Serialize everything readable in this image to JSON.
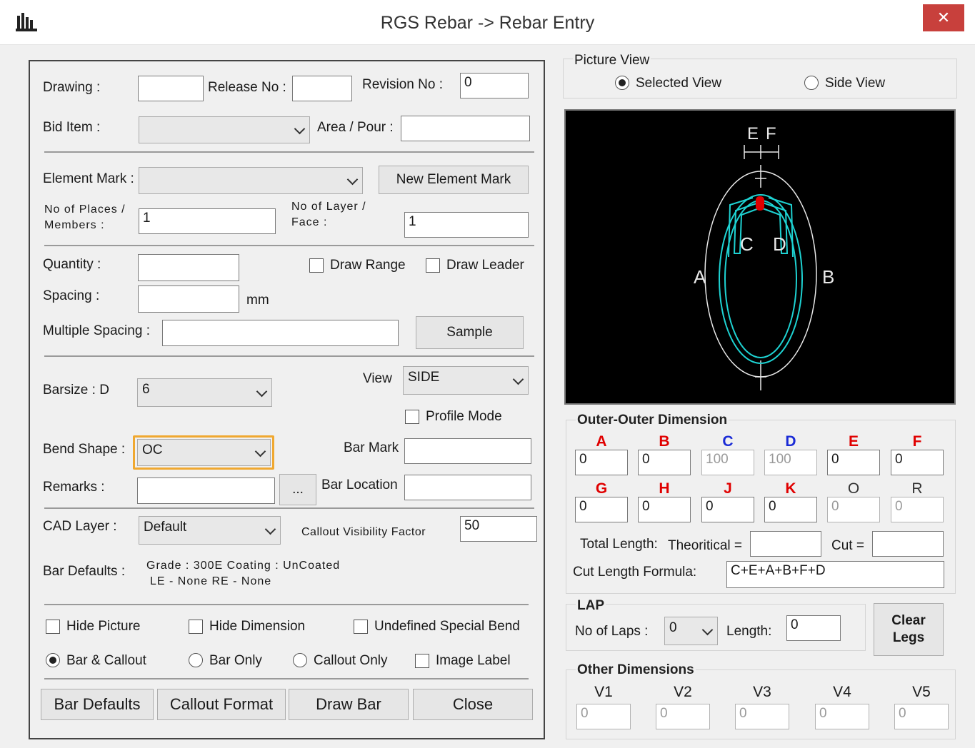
{
  "window": {
    "title": "RGS Rebar -> Rebar Entry",
    "close_glyph": "✕"
  },
  "form": {
    "drawing_label": "Drawing :",
    "drawing_value": "",
    "release_label": "Release No :",
    "release_value": "",
    "revision_label": "Revision No :",
    "revision_value": "0",
    "bid_label": "Bid Item :",
    "bid_value": "",
    "area_label": "Area / Pour :",
    "area_value": "",
    "element_label": "Element Mark :",
    "element_value": "",
    "new_element_button": "New Element Mark",
    "places_label_1": "No of Places /",
    "places_label_2": "Members    :",
    "places_value": "1",
    "layer_label_1": "No of Layer /",
    "layer_label_2": "Face :",
    "layer_value": "1",
    "quantity_label": "Quantity :",
    "quantity_value": "",
    "draw_range_label": "Draw Range",
    "draw_leader_label": "Draw Leader",
    "spacing_label": "Spacing :",
    "spacing_value": "",
    "spacing_unit": "mm",
    "multi_spacing_label": "Multiple Spacing :",
    "multi_spacing_value": "",
    "sample_button": "Sample",
    "barsize_label": "Barsize  : D",
    "barsize_value": "6",
    "view_label": "View",
    "view_value": "SIDE",
    "profile_mode_label": "Profile Mode",
    "bend_shape_label": "Bend Shape :",
    "bend_shape_value": "OC",
    "bar_mark_label": "Bar Mark",
    "bar_mark_value": "",
    "remarks_label": "Remarks :",
    "remarks_value": "",
    "ellipsis_button": "...",
    "bar_location_label": "Bar Location",
    "bar_location_value": "",
    "cad_layer_label": "CAD Layer :",
    "cad_layer_value": "Default",
    "callout_factor_label": "Callout Visibility Factor",
    "callout_factor_value": "50",
    "bar_defaults_label": "Bar Defaults :",
    "bar_defaults_line1": "Grade : 300E Coating : UnCoated",
    "bar_defaults_line2": "LE - None RE - None",
    "hide_picture_label": "Hide Picture",
    "hide_dimension_label": "Hide Dimension",
    "undefined_bend_label": "Undefined Special Bend",
    "bar_callout_label": "Bar & Callout",
    "bar_only_label": "Bar Only",
    "callout_only_label": "Callout Only",
    "image_label_label": "Image Label"
  },
  "buttons": {
    "bar_defaults": "Bar Defaults",
    "callout_format": "Callout Format",
    "draw_bar": "Draw Bar",
    "close": "Close"
  },
  "picture": {
    "title": "Picture View",
    "selected_view": "Selected View",
    "side_view": "Side View",
    "labels": {
      "A": "A",
      "B": "B",
      "C": "C",
      "D": "D",
      "E": "E",
      "F": "F"
    }
  },
  "outer": {
    "title": "Outer-Outer Dimension",
    "row1": [
      {
        "key": "A",
        "value": "0",
        "disabled": false
      },
      {
        "key": "B",
        "value": "0",
        "disabled": false
      },
      {
        "key": "C",
        "value": "100",
        "disabled": true
      },
      {
        "key": "D",
        "value": "100",
        "disabled": true
      },
      {
        "key": "E",
        "value": "0",
        "disabled": false
      },
      {
        "key": "F",
        "value": "0",
        "disabled": false
      }
    ],
    "row2": [
      {
        "key": "G",
        "value": "0",
        "disabled": false
      },
      {
        "key": "H",
        "value": "0",
        "disabled": false
      },
      {
        "key": "J",
        "value": "0",
        "disabled": false
      },
      {
        "key": "K",
        "value": "0",
        "disabled": false
      },
      {
        "key": "O",
        "value": "0",
        "disabled": true
      },
      {
        "key": "R",
        "value": "0",
        "disabled": true
      }
    ],
    "total_length_label": "Total Length:",
    "theoretical_label": "Theoritical =",
    "theoretical_value": "",
    "cut_label": "Cut =",
    "cut_value": "",
    "formula_label": "Cut Length Formula:",
    "formula_value": "C+E+A+B+F+D"
  },
  "lap": {
    "title": "LAP",
    "laps_label": "No of Laps :",
    "laps_value": "0",
    "length_label": "Length:",
    "length_value": "0",
    "clear_legs_1": "Clear",
    "clear_legs_2": "Legs"
  },
  "other": {
    "title": "Other Dimensions",
    "items": [
      {
        "key": "V1",
        "value": "0"
      },
      {
        "key": "V2",
        "value": "0"
      },
      {
        "key": "V3",
        "value": "0"
      },
      {
        "key": "V4",
        "value": "0"
      },
      {
        "key": "V5",
        "value": "0"
      }
    ]
  },
  "colors": {
    "dim_key_red": "#e00000",
    "dim_key_blue": "#1a2bd6",
    "highlight": "#f0a830",
    "canvas_bg": "#000000",
    "bar_cyan": "#1ed2d2",
    "close_red": "#c8403c"
  }
}
